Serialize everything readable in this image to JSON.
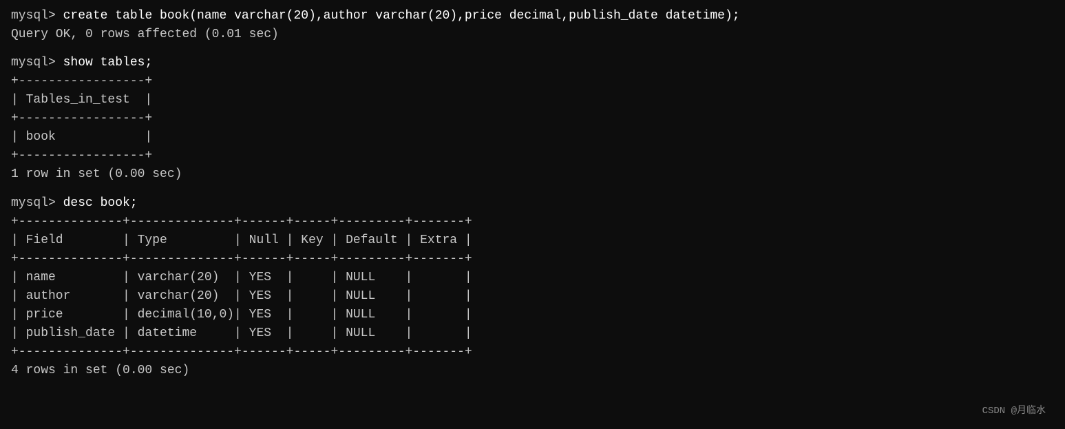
{
  "terminal": {
    "lines": [
      {
        "type": "command",
        "prompt": "mysql> ",
        "cmd": "create table book(name varchar(20),author varchar(20),price decimal,publish_date datetime);"
      },
      {
        "type": "result",
        "text": "Query OK, 0 rows affected (0.01 sec)"
      },
      {
        "type": "spacer"
      },
      {
        "type": "command",
        "prompt": "mysql> ",
        "cmd": "show tables;"
      },
      {
        "type": "border",
        "text": "+-----------------+"
      },
      {
        "type": "result",
        "text": "| Tables_in_test  |"
      },
      {
        "type": "border",
        "text": "+-----------------+"
      },
      {
        "type": "result",
        "text": "| book            |"
      },
      {
        "type": "border",
        "text": "+-----------------+"
      },
      {
        "type": "result",
        "text": "1 row in set (0.00 sec)"
      },
      {
        "type": "spacer"
      },
      {
        "type": "command",
        "prompt": "mysql> ",
        "cmd": "desc book;"
      },
      {
        "type": "border",
        "text": "+--------------+--------------+------+-----+---------+-------+"
      },
      {
        "type": "result",
        "text": "| Field        | Type         | Null | Key | Default | Extra |"
      },
      {
        "type": "border",
        "text": "+--------------+--------------+------+-----+---------+-------+"
      },
      {
        "type": "result",
        "text": "| name         | varchar(20)  | YES  |     | NULL    |       |"
      },
      {
        "type": "result",
        "text": "| author       | varchar(20)  | YES  |     | NULL    |       |"
      },
      {
        "type": "result",
        "text": "| price        | decimal(10,0)| YES  |     | NULL    |       |"
      },
      {
        "type": "result",
        "text": "| publish_date | datetime     | YES  |     | NULL    |       |"
      },
      {
        "type": "border",
        "text": "+--------------+--------------+------+-----+---------+-------+"
      },
      {
        "type": "result",
        "text": "4 rows in set (0.00 sec)"
      }
    ],
    "watermark": "CSDN @月临水"
  }
}
